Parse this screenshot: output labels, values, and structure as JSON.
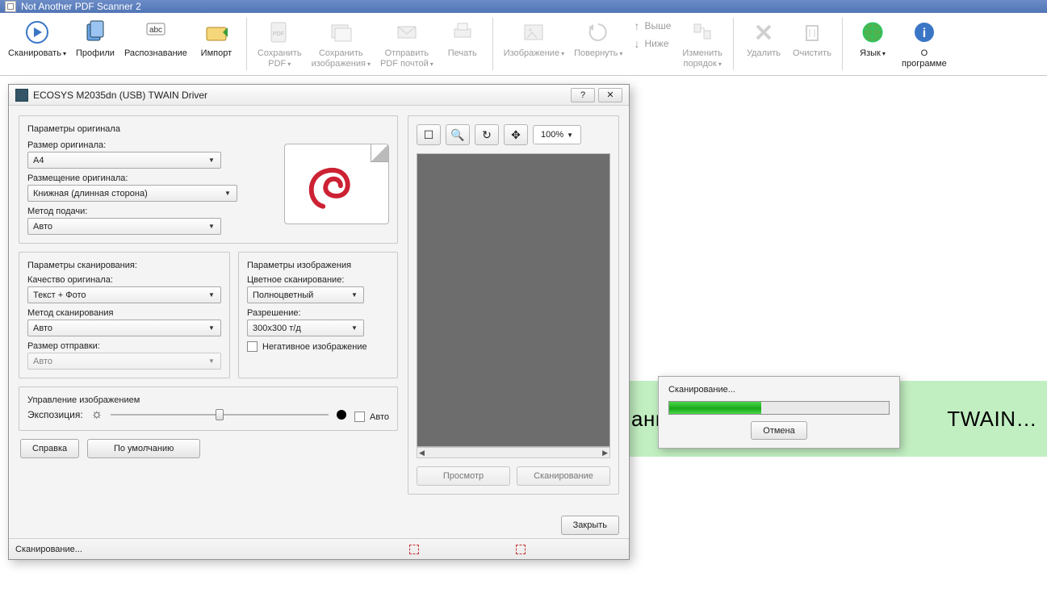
{
  "app": {
    "title": "Not Another PDF Scanner 2"
  },
  "ribbon": {
    "scan": "Сканировать",
    "profiles": "Профили",
    "ocr": "Распознавание",
    "import": "Импорт",
    "savepdf_l1": "Сохранить",
    "savepdf_l2": "PDF",
    "saveimg_l1": "Сохранить",
    "saveimg_l2": "изображения",
    "sendpdf_l1": "Отправить",
    "sendpdf_l2": "PDF почтой",
    "print": "Печать",
    "image": "Изображение",
    "rotate": "Повернуть",
    "moveup": "Выше",
    "movedown": "Ниже",
    "reorder_l1": "Изменить",
    "reorder_l2": "порядок",
    "delete": "Удалить",
    "clear": "Очистить",
    "lang": "Язык",
    "about_l1": "О",
    "about_l2": "программе"
  },
  "greenstrip": {
    "left": "ани",
    "right": "TWAIN…"
  },
  "dlg": {
    "title": "ECOSYS M2035dn (USB) TWAIN Driver",
    "orig_header": "Параметры оригинала",
    "size_label": "Размер оригинала:",
    "size_value": "A4",
    "orient_label": "Размещение оригинала:",
    "orient_value": "Книжная (длинная сторона)",
    "feed_label": "Метод подачи:",
    "feed_value": "Авто",
    "scanparam_header": "Параметры сканирования:",
    "quality_label": "Качество оригинала:",
    "quality_value": "Текст + Фото",
    "method_label": "Метод сканирования",
    "method_value": "Авто",
    "sendsize_label": "Размер отправки:",
    "sendsize_value": "Авто",
    "imgparam_header": "Параметры изображения",
    "color_label": "Цветное сканирование:",
    "color_value": "Полноцветный",
    "res_label": "Разрешение:",
    "res_value": "300х300 т/д",
    "negative": "Негативное изображение",
    "expos_header": "Управление изображением",
    "exposure_label": "Экспозиция:",
    "auto": "Авто",
    "help": "Справка",
    "defaults": "По умолчанию",
    "close": "Закрыть",
    "zoom": "100%",
    "previewbtn": "Просмотр",
    "scanbtn": "Сканирование",
    "status": "Сканирование..."
  },
  "popup": {
    "title": "Сканирование...",
    "cancel": "Отмена"
  }
}
